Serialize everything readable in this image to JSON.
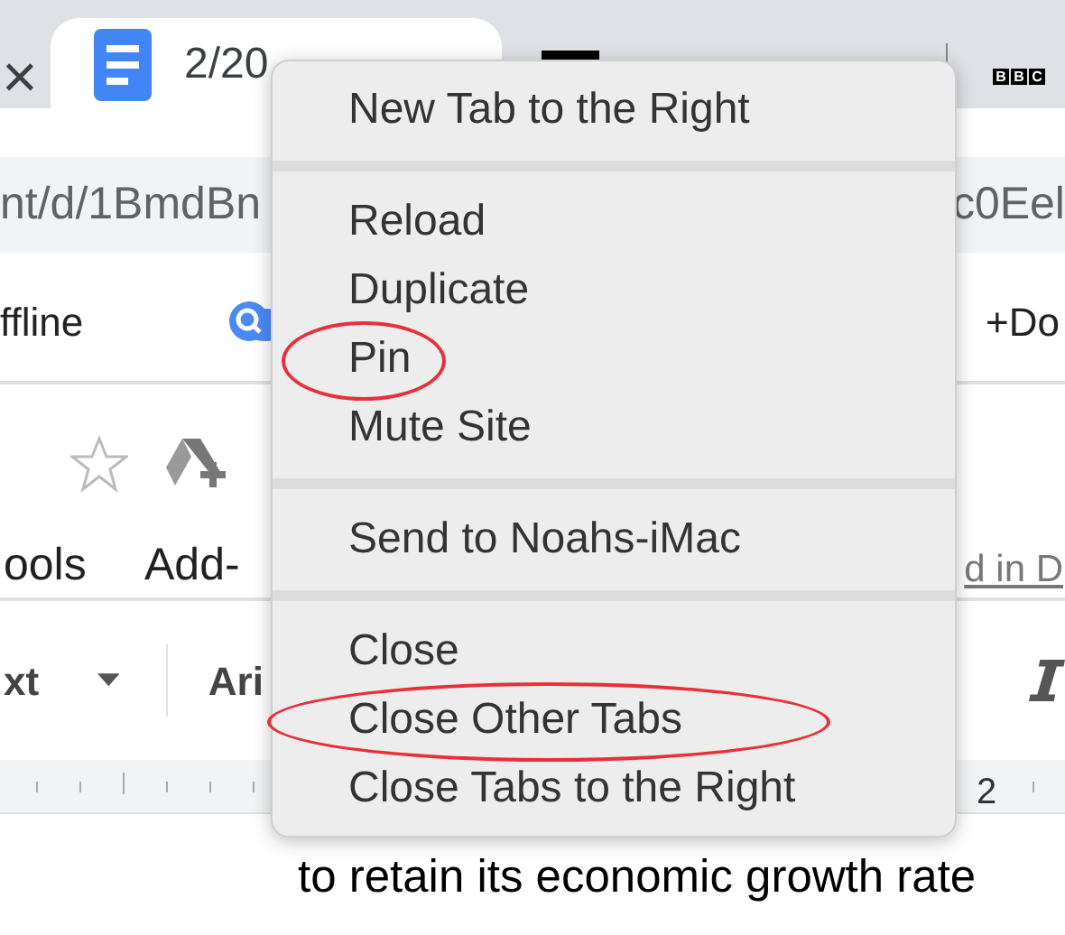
{
  "tab_bar": {
    "close_glyph": "×",
    "active_tab": {
      "title": "2/20",
      "selected": true
    },
    "bbc_letters": [
      "B",
      "B",
      "C"
    ]
  },
  "address_bar": {
    "left_text": "nt/d/1BmdBn",
    "right_text": "c0Eel"
  },
  "bookmarks_bar": {
    "left_text": "ffline",
    "right_text": "+Do"
  },
  "docs_header": {
    "menus": [
      "ools",
      "Add-"
    ],
    "link": "d in D"
  },
  "toolbar": {
    "style_select": "xt",
    "font_select": "Ari"
  },
  "ruler": {
    "number": "2"
  },
  "document": {
    "line": "to retain its economic growth rate"
  },
  "context_menu": {
    "groups": [
      [
        {
          "label": "New Tab to the Right",
          "circled": false
        }
      ],
      [
        {
          "label": "Reload",
          "circled": false
        },
        {
          "label": "Duplicate",
          "circled": false
        },
        {
          "label": "Pin",
          "circled": true
        },
        {
          "label": "Mute Site",
          "circled": false
        }
      ],
      [
        {
          "label": "Send to Noahs-iMac",
          "circled": false
        }
      ],
      [
        {
          "label": "Close",
          "circled": false
        },
        {
          "label": "Close Other Tabs",
          "circled": true
        },
        {
          "label": "Close Tabs to the Right",
          "circled": false
        }
      ]
    ]
  }
}
